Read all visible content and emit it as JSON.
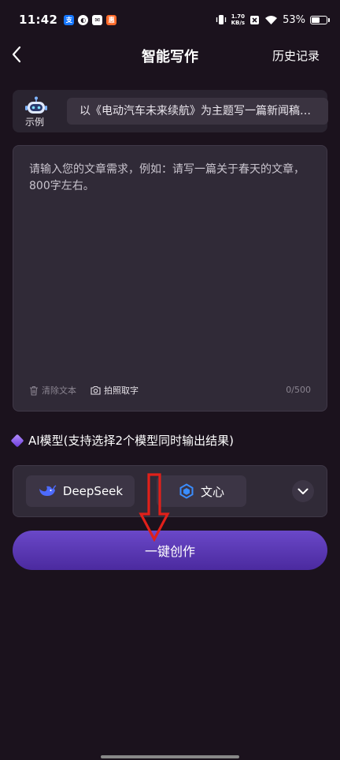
{
  "status_bar": {
    "time": "11:42",
    "speed_value": "1.70",
    "speed_unit": "KB/s",
    "battery": "53%",
    "battery_level": 0.53,
    "app_icons": [
      {
        "name": "alipay-icon",
        "glyph": "支",
        "color": "#1677ff"
      },
      {
        "name": "app-circle-icon",
        "glyph": "◐",
        "color": "#ffffff"
      },
      {
        "name": "mail-icon",
        "glyph": "✉",
        "color": "#ffffff"
      },
      {
        "name": "coupon-app-icon",
        "glyph": "惠",
        "color": "#ff6a2a"
      }
    ]
  },
  "header": {
    "title": "智能写作",
    "history": "历史记录"
  },
  "example": {
    "label": "示例",
    "text": "以《电动汽车未来续航》为主题写一篇新闻稿…"
  },
  "editor": {
    "placeholder": "请输入您的文章需求，例如：请写一篇关于春天的文章，800字左右。",
    "clear_label": "清除文本",
    "photo_label": "拍照取字",
    "counter": "0/500"
  },
  "models": {
    "title": "AI模型(支持选择2个模型同时输出结果)",
    "options": [
      {
        "name": "DeepSeek",
        "icon": "deepseek-whale-icon"
      },
      {
        "name": "文心",
        "icon": "wenxin-cube-icon"
      }
    ]
  },
  "action": {
    "create_label": "一键创作"
  },
  "colors": {
    "background": "#1b121d",
    "card": "#302a37",
    "accent": "#5a36b8",
    "annotation": "#e0201a"
  }
}
